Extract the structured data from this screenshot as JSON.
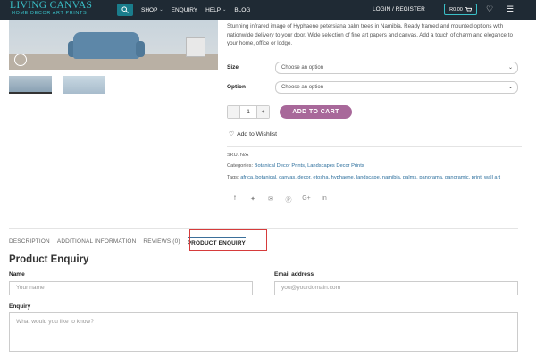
{
  "header": {
    "logo_line1": "LIVING CANVAS",
    "logo_line2": "HOME DECOR ART PRINTS",
    "nav": [
      {
        "label": "SHOP",
        "has_dropdown": true
      },
      {
        "label": "ENQUIRY",
        "has_dropdown": false
      },
      {
        "label": "HELP",
        "has_dropdown": true
      },
      {
        "label": "BLOG",
        "has_dropdown": false
      }
    ],
    "login_label": "LOGIN / REGISTER",
    "cart_total": "R0.00",
    "icons": {
      "search": "search-icon",
      "cart": "cart-icon",
      "wishlist": "heart-icon",
      "menu": "hamburger-icon"
    },
    "colors": {
      "bar": "#1f2a34",
      "accent": "#3ac0c8"
    }
  },
  "product": {
    "description": "Stunning infrared image of Hyphaene petersiana palm trees in Namibia. Ready framed and mounted options with nationwide delivery to your door. Wide selection of fine art papers and canvas. Add a touch of charm and elegance to your home, office or lodge.",
    "size_label": "Size",
    "size_placeholder": "Choose an option",
    "option_label": "Option",
    "option_placeholder": "Choose an option",
    "qty_minus": "-",
    "qty_value": "1",
    "qty_plus": "+",
    "add_to_cart": "ADD TO CART",
    "add_to_cart_color": "#a8689a",
    "wishlist": "Add to Wishlist",
    "sku": "SKU: N/A",
    "categories_prefix": "Categories: ",
    "categories": "Botanical Decor Prints, Landscapes Decor Prints",
    "tags_prefix": "Tags: ",
    "tags": "africa, botanical, canvas, decor, etosha, hyphaene, landscape, namibia, palms, panorama, panoramic, print, wall art",
    "share_icons": [
      "facebook-icon",
      "twitter-icon",
      "email-icon",
      "pinterest-icon",
      "google-plus-icon",
      "linkedin-icon"
    ]
  },
  "tabs": [
    {
      "label": "DESCRIPTION",
      "active": false
    },
    {
      "label": "ADDITIONAL INFORMATION",
      "active": false
    },
    {
      "label": "REVIEWS (0)",
      "active": false
    },
    {
      "label": "PRODUCT ENQUIRY",
      "active": true
    }
  ],
  "form": {
    "title": "Product Enquiry",
    "name_label": "Name",
    "name_placeholder": "Your name",
    "email_label": "Email address",
    "email_placeholder": "you@yourdomain.com",
    "enquiry_label": "Enquiry",
    "enquiry_placeholder": "What would you like to know?"
  }
}
